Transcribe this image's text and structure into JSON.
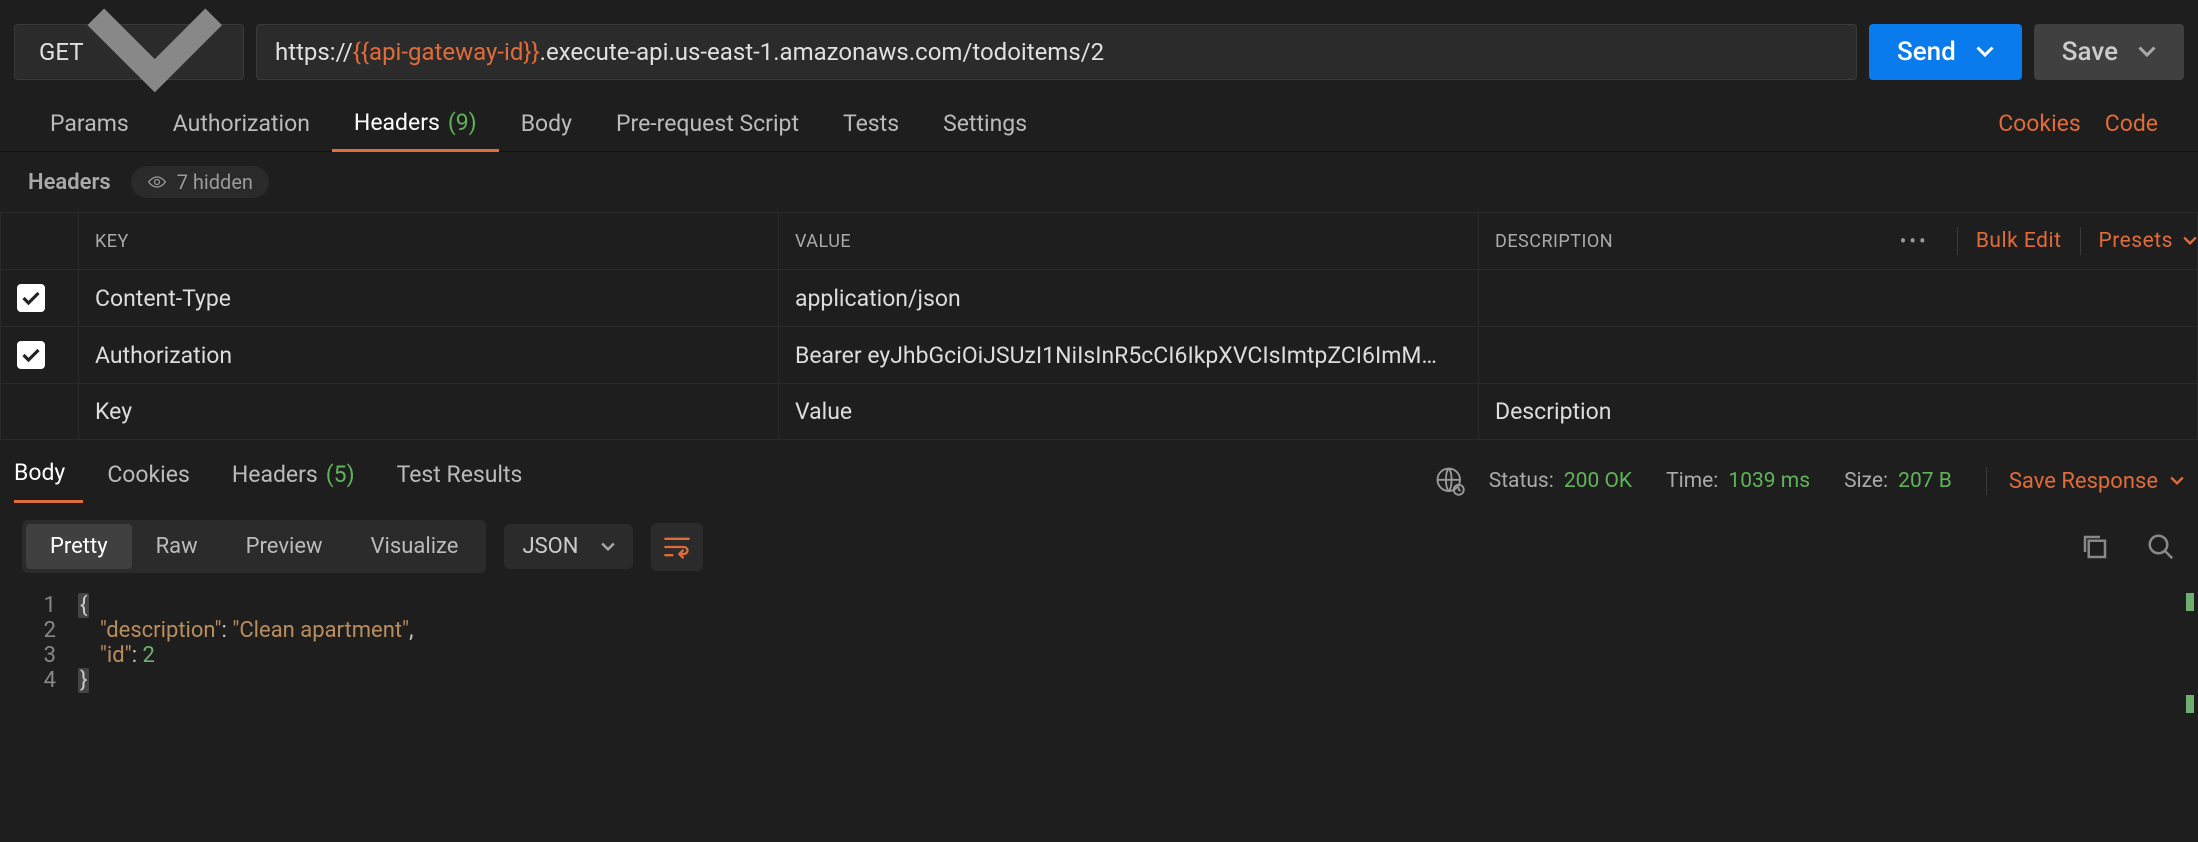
{
  "request": {
    "method": "GET",
    "url_prefix": "https://",
    "url_var": "{{api-gateway-id}}",
    "url_suffix": ".execute-api.us-east-1.amazonaws.com/todoitems/2",
    "send_label": "Send",
    "save_label": "Save"
  },
  "tabs": {
    "params": "Params",
    "authorization": "Authorization",
    "headers": "Headers",
    "headers_count": "(9)",
    "body": "Body",
    "prerequest": "Pre-request Script",
    "tests": "Tests",
    "settings": "Settings",
    "cookies_link": "Cookies",
    "code_link": "Code"
  },
  "headers_section": {
    "title": "Headers",
    "hidden_label": "7 hidden",
    "key_header": "KEY",
    "value_header": "VALUE",
    "desc_header": "DESCRIPTION",
    "bulk_edit": "Bulk Edit",
    "presets": "Presets",
    "rows": [
      {
        "key": "Content-Type",
        "value": "application/json",
        "desc": ""
      },
      {
        "key": "Authorization",
        "value": "Bearer eyJhbGciOiJSUzI1NiIsInR5cCI6IkpXVCIsImtpZCI6ImM…",
        "desc": ""
      }
    ],
    "placeholder_key": "Key",
    "placeholder_value": "Value",
    "placeholder_desc": "Description"
  },
  "response_tabs": {
    "body": "Body",
    "cookies": "Cookies",
    "headers": "Headers",
    "headers_count": "(5)",
    "test_results": "Test Results"
  },
  "response_meta": {
    "status_label": "Status:",
    "status_value": "200 OK",
    "time_label": "Time:",
    "time_value": "1039 ms",
    "size_label": "Size:",
    "size_value": "207 B",
    "save_response": "Save Response"
  },
  "format": {
    "pretty": "Pretty",
    "raw": "Raw",
    "preview": "Preview",
    "visualize": "Visualize",
    "lang": "JSON"
  },
  "response_body": {
    "line1": "{",
    "line2_key": "\"description\"",
    "line2_colon": ": ",
    "line2_val": "\"Clean apartment\"",
    "line2_comma": ",",
    "line3_key": "\"id\"",
    "line3_colon": ": ",
    "line3_val": "2",
    "line4": "}"
  }
}
